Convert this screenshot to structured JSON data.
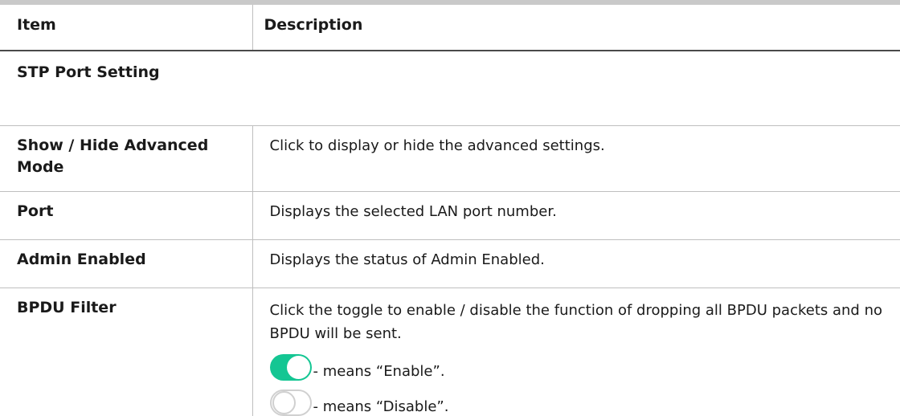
{
  "table": {
    "header": {
      "item": "Item",
      "description": "Description"
    },
    "section": "STP Port Setting",
    "rows": [
      {
        "item": "Show / Hide Advanced\nMode",
        "description": "Click to display or hide the advanced settings."
      },
      {
        "item": "Port",
        "description": "Displays the selected LAN port number."
      },
      {
        "item": "Admin Enabled",
        "description": "Displays the status of Admin Enabled."
      },
      {
        "item": "BPDU Filter",
        "description": "Click the toggle to enable / disable the function of dropping all BPDU packets and no BPDU will be sent.",
        "toggles": [
          {
            "state": "on",
            "text": "- means “Enable”."
          },
          {
            "state": "off",
            "text": "- means “Disable”."
          }
        ]
      }
    ]
  },
  "colors": {
    "toggle_on": "#14c693",
    "toggle_off_border": "#d0d0d0",
    "rule": "#c9c9c9",
    "grid": "#bfbfbf"
  }
}
